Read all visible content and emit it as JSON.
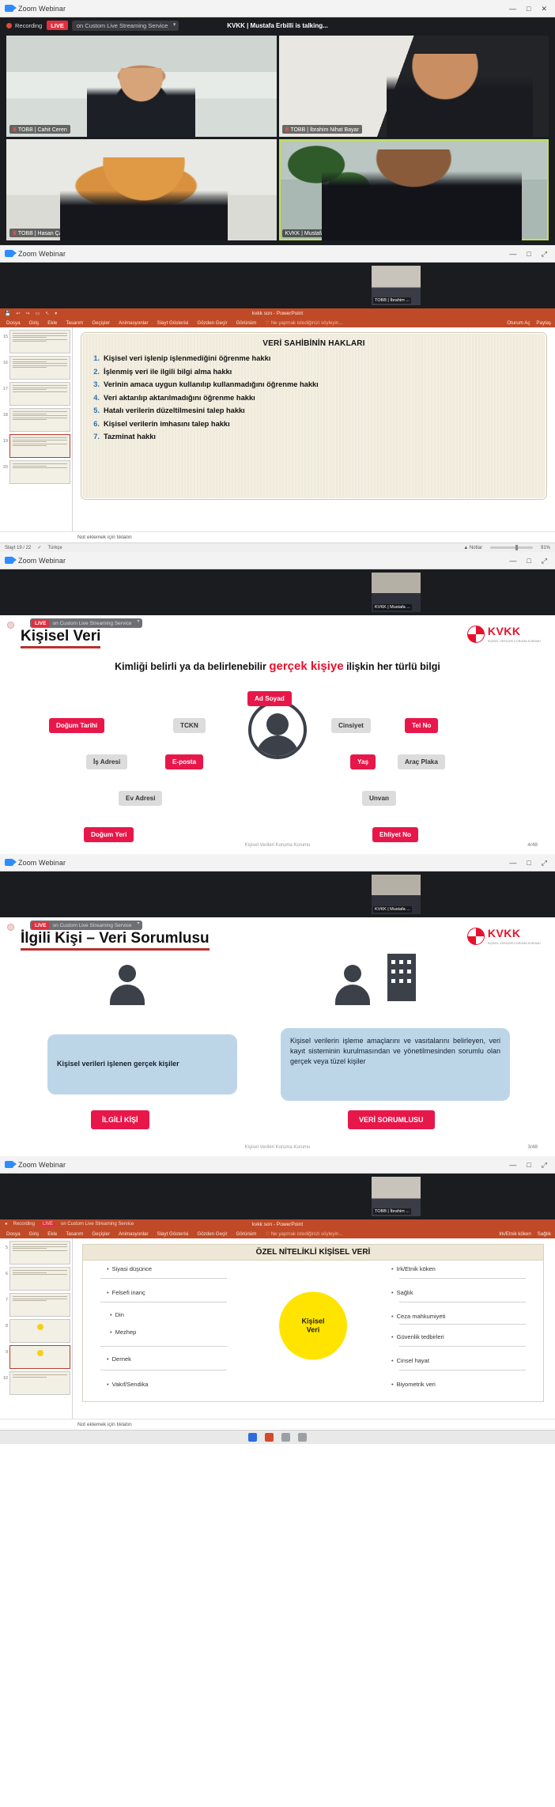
{
  "window": {
    "title": "Zoom Webinar",
    "minimize": "—",
    "maximize": "□",
    "close": "✕",
    "restore": "⤢"
  },
  "zoom_bar": {
    "recording_label": "Recording",
    "live_badge": "LIVE",
    "stream_service": "on Custom Live Streaming Service",
    "talking_status": "KVKK | Mustafa Erbilli is talking..."
  },
  "gallery": {
    "participants": [
      {
        "org": "TOBB",
        "name": "Cahit Ceren",
        "label": "TOBB | Cahit Ceren",
        "active": false
      },
      {
        "org": "TOBB",
        "name": "İbrahim Nihat Bayar",
        "label": "TOBB | İbrahim Nihat Bayar",
        "active": false
      },
      {
        "org": "TOBB",
        "name": "Hasan Çağlayan Dündar",
        "label": "TOBB | Hasan Çağlayan Dündar",
        "active": false
      },
      {
        "org": "KVKK",
        "name": "Mustafa Erbilli",
        "label": "KVKK | Mustafa Erbilli",
        "active": true
      }
    ]
  },
  "powerpoint": {
    "doc_title": "kvkk son - PowerPoint",
    "tabs": [
      "Dosya",
      "Giriş",
      "Ekle",
      "Tasarım",
      "Geçişler",
      "Animasyonlar",
      "Slayt Gösterisi",
      "Gözden Geçir",
      "Görünüm"
    ],
    "tell_me": "Ne yapmak istediğinizi söyleyin...",
    "right_items": [
      "Oturum Aç",
      "Paylaş"
    ],
    "notes_placeholder": "Not eklemek için tıklatın",
    "status": {
      "slide_counter": "Slayt 19 / 22",
      "language": "Türkçe",
      "notes_button": "Notlar",
      "zoom_level": "91%"
    },
    "self_video_label": "TOBB | İbrahim ...",
    "thumbnails": [
      {
        "no": "15",
        "selected": false
      },
      {
        "no": "16",
        "selected": false
      },
      {
        "no": "17",
        "selected": false
      },
      {
        "no": "18",
        "selected": false
      },
      {
        "no": "19",
        "selected": true
      },
      {
        "no": "20",
        "selected": false
      }
    ],
    "slide": {
      "heading": "VERİ SAHİBİNİN HAKLARI",
      "items": [
        "Kişisel veri işlenip işlenmediğini öğrenme hakkı",
        "İşlenmiş veri ile ilgili bilgi alma hakkı",
        "Verinin amaca uygun kullanılıp kullanmadığını öğrenme hakkı",
        "Veri aktarılıp aktarılmadığını öğrenme hakkı",
        "Hatalı verilerin düzeltilmesini talep hakkı",
        "Kişisel verilerin imhasını talep hakkı",
        "Tazminat hakkı"
      ]
    }
  },
  "slide_kisisel_veri": {
    "self_video_label": "KVKK | Mustafa ...",
    "live_badge": "LIVE",
    "stream_service": "on Custom Live Streaming Service",
    "title": "Kişisel Veri",
    "logo_text": "KVKK",
    "logo_sub": "KİŞİSEL VERİLERİ KORUMA KURUMU",
    "subtitle_pre": "Kimliği belirli ya da belirlenebilir ",
    "subtitle_red": "gerçek kişiye",
    "subtitle_post": " ilişkin her türlü bilgi",
    "chips": [
      {
        "label": "Ad Soyad",
        "style": "red"
      },
      {
        "label": "Doğum Tarihi",
        "style": "red"
      },
      {
        "label": "TCKN",
        "style": "gray"
      },
      {
        "label": "Cinsiyet",
        "style": "gray"
      },
      {
        "label": "Tel No",
        "style": "red"
      },
      {
        "label": "İş Adresi",
        "style": "gray"
      },
      {
        "label": "E-posta",
        "style": "red"
      },
      {
        "label": "Yaş",
        "style": "red"
      },
      {
        "label": "Araç Plaka",
        "style": "gray"
      },
      {
        "label": "Ev Adresi",
        "style": "gray"
      },
      {
        "label": "Unvan",
        "style": "gray"
      },
      {
        "label": "Doğum Yeri",
        "style": "red"
      },
      {
        "label": "Ehliyet No",
        "style": "red"
      }
    ],
    "footer": "Kişisel Verileri Koruma Kurumu",
    "page_number": "4/48"
  },
  "slide_ilgili_kisi": {
    "self_video_label": "KVKK | Mustafa ...",
    "live_badge": "LIVE",
    "stream_service": "on Custom Live Streaming Service",
    "title": "İlgili Kişi – Veri Sorumlusu",
    "logo_text": "KVKK",
    "logo_sub": "KİŞİSEL VERİLERİ KORUMA KURUMU",
    "left_box": "Kişisel verileri işlenen gerçek kişiler",
    "right_box": "Kişisel verilerin işleme amaçlarını ve vasıtalarını belirleyen, veri kayıt sisteminin kurulmasından ve yönetilmesinden sorumlu olan gerçek veya tüzel kişiler",
    "left_button": "İLGİLİ KİŞİ",
    "right_button": "VERİ SORUMLUSU",
    "footer": "Kişisel Verileri Koruma Kurumu",
    "page_number": "3/48"
  },
  "slide_ozel_nitelikli": {
    "self_video_label": "TOBB | İbrahim ...",
    "doc_title": "kvkk son - PowerPoint",
    "tabs": [
      "Dosya",
      "Giriş",
      "Ekle",
      "Tasarım",
      "Geçişler",
      "Animasyonlar",
      "Slayt Gösterisi",
      "Gözden Geçir",
      "Görünüm"
    ],
    "tell_me": "Ne yapmak istediğinizi söyleyin...",
    "right_items": [
      "Irk/Etnik köken",
      "Sağlık",
      "Ceza mahkumiyeti",
      "Güvenlik tedbirleri",
      "Cinsel hayat",
      "Biyometrik veri"
    ],
    "recording_label": "Recording",
    "live_badge": "LIVE",
    "stream_service": "on Custom Live Streaming Service",
    "notes_placeholder": "Not eklemek için tıklatın",
    "heading": "ÖZEL NİTELİKLİ KİŞİSEL VERİ",
    "center_label_line1": "Kişisel",
    "center_label_line2": "Veri",
    "left_items": [
      "Siyasi düşünce",
      "Felsefi inanç",
      "Din",
      "Mezhep",
      "Dernek",
      "Vakıf/Sendika"
    ],
    "thumbnails": [
      {
        "no": "5",
        "selected": false
      },
      {
        "no": "6",
        "selected": false
      },
      {
        "no": "7",
        "selected": false
      },
      {
        "no": "8",
        "selected": false
      },
      {
        "no": "9",
        "selected": true
      },
      {
        "no": "10",
        "selected": false
      }
    ]
  }
}
